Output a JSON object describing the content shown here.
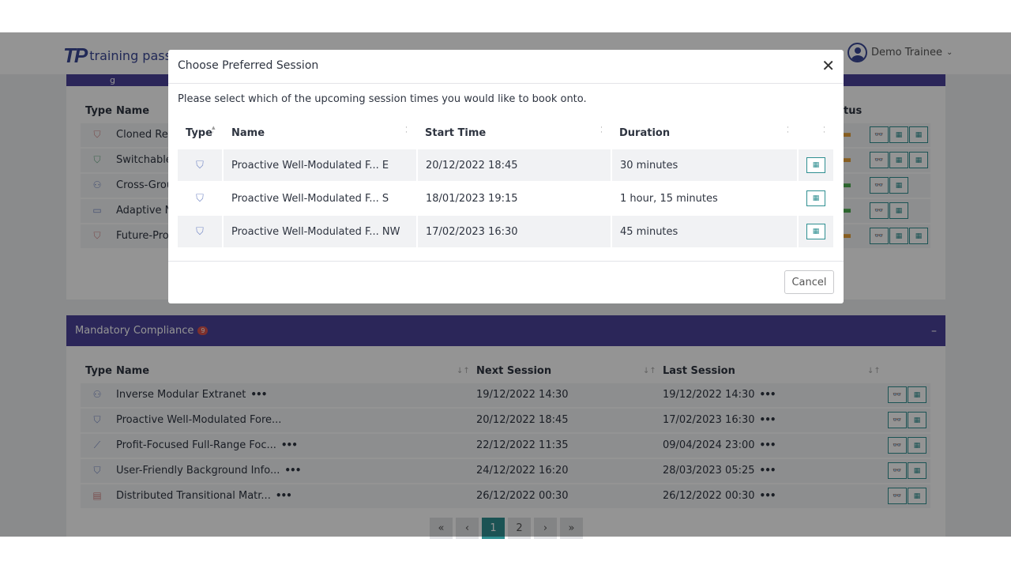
{
  "header": {
    "logo_mark": "TP",
    "logo_text": "training pass",
    "user_name": "Demo Trainee",
    "user_chevron": "⌄"
  },
  "upcoming": {
    "title_fragment": "g",
    "col_type": "Type",
    "col_name": "Name",
    "col_status": "tus",
    "rows": [
      {
        "name": "Cloned Rec",
        "icon": "group-icon"
      },
      {
        "name": "Switchable",
        "icon": "group-icon"
      },
      {
        "name": "Cross-Grou",
        "icon": "person-icon"
      },
      {
        "name": "Adaptive Ne",
        "icon": "screen-icon"
      },
      {
        "name": "Future-Proo",
        "icon": "group-icon"
      }
    ]
  },
  "mandatory": {
    "title": "Mandatory Compliance",
    "count": "9",
    "collapse": "–",
    "col_type": "Type",
    "col_name": "Name",
    "col_next": "Next Session",
    "col_last": "Last Session",
    "rows": [
      {
        "name": "Inverse Modular Extranet",
        "more": "•••",
        "next": "19/12/2022 14:30",
        "last": "19/12/2022 14:30",
        "last_more": "•••"
      },
      {
        "name": "Proactive Well-Modulated Fore...",
        "more": "",
        "next": "20/12/2022 18:45",
        "last": "17/02/2023 16:30",
        "last_more": "•••"
      },
      {
        "name": "Profit-Focused Full-Range Foc...",
        "more": "•••",
        "next": "22/12/2022 11:35",
        "last": "09/04/2024 23:00",
        "last_more": "•••"
      },
      {
        "name": "User-Friendly Background Info...",
        "more": "•••",
        "next": "24/12/2022 16:20",
        "last": "28/03/2023 05:25",
        "last_more": "•••"
      },
      {
        "name": "Distributed Transitional Matr...",
        "more": "•••",
        "next": "26/12/2022 00:30",
        "last": "26/12/2022 00:30",
        "last_more": "•••"
      }
    ]
  },
  "pagination": {
    "first": "«",
    "prev": "‹",
    "page1": "1",
    "page2": "2",
    "next": "›",
    "last": "»"
  },
  "modal": {
    "title": "Choose Preferred Session",
    "close": "✕",
    "prompt": "Please select which of the upcoming session times you would like to book onto.",
    "col_type": "Type",
    "col_name": "Name",
    "col_start": "Start Time",
    "col_duration": "Duration",
    "sessions": [
      {
        "name": "Proactive Well-Modulated F... E",
        "start": "20/12/2022 18:45",
        "duration": "30 minutes"
      },
      {
        "name": "Proactive Well-Modulated F... S",
        "start": "18/01/2023 19:15",
        "duration": "1 hour, 15 minutes"
      },
      {
        "name": "Proactive Well-Modulated F... NW",
        "start": "17/02/2023 16:30",
        "duration": "45 minutes"
      }
    ],
    "cancel": "Cancel"
  }
}
